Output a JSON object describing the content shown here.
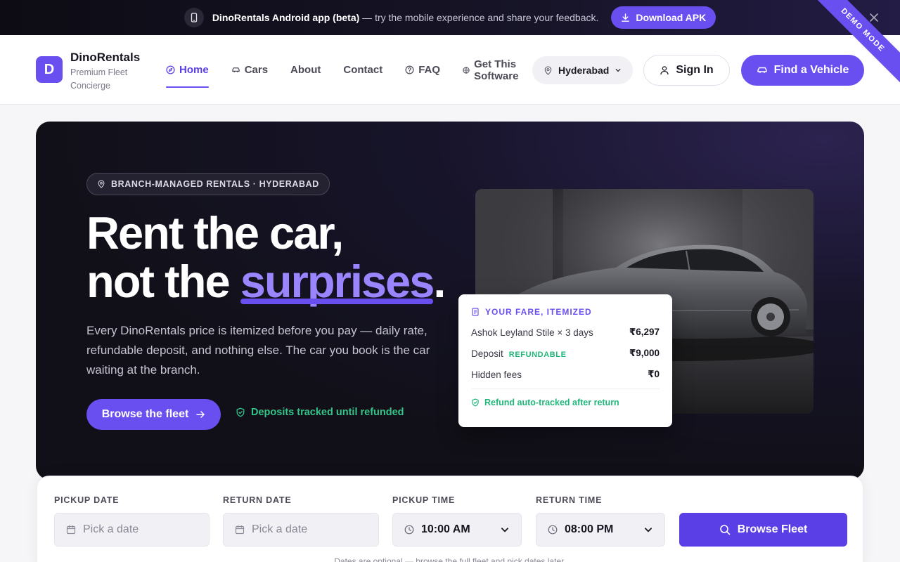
{
  "promo": {
    "title": "DinoRentals Android app (beta)",
    "rest": " — try the mobile experience and share your feedback.",
    "button": "Download APK"
  },
  "ribbon": "DEMO MODE",
  "brand": {
    "initial": "D",
    "name": "DinoRentals",
    "tagline": "Premium Fleet Concierge"
  },
  "nav": {
    "items": [
      {
        "label": "Home",
        "icon": "compass-icon",
        "active": true
      },
      {
        "label": "Cars",
        "icon": "car-icon"
      },
      {
        "label": "About"
      },
      {
        "label": "Contact"
      },
      {
        "label": "FAQ",
        "icon": "help-circle-icon"
      },
      {
        "label_line1": "Get This",
        "label_line2": "Software",
        "icon": "globe-icon"
      }
    ],
    "city": "Hyderabad",
    "signin": "Sign In",
    "find": "Find a Vehicle"
  },
  "hero": {
    "chip": "BRANCH-MANAGED RENTALS · HYDERABAD",
    "line1": "Rent the car,",
    "line2_pre": "not the ",
    "line2_accent": "surprises",
    "line2_post": ".",
    "lead": "Every DinoRentals price is itemized before you pay — daily rate, refundable deposit, and nothing else. The car you book is the car waiting at the branch.",
    "cta": "Browse the fleet",
    "deposits": "Deposits tracked until refunded"
  },
  "fare": {
    "title": "YOUR FARE, ITEMIZED",
    "rows": [
      {
        "label": "Ashok Leyland Stile × 3 days",
        "value": "₹6,297"
      },
      {
        "label": "Deposit",
        "badge": "REFUNDABLE",
        "value": "₹9,000"
      },
      {
        "label": "Hidden fees",
        "value": "₹0"
      }
    ],
    "foot": "Refund auto-tracked after return"
  },
  "booking": {
    "pickup_date": {
      "label": "PICKUP DATE",
      "placeholder": "Pick a date"
    },
    "return_date": {
      "label": "RETURN DATE",
      "placeholder": "Pick a date"
    },
    "pickup_time": {
      "label": "PICKUP TIME",
      "value": "10:00 AM"
    },
    "return_time": {
      "label": "RETURN TIME",
      "value": "08:00 PM"
    },
    "button": "Browse Fleet",
    "note": "Dates are optional — browse the full fleet and pick dates later."
  },
  "colors": {
    "accent": "#6a4ff0",
    "success": "#1fb67a",
    "hero_bg": "#111018"
  }
}
